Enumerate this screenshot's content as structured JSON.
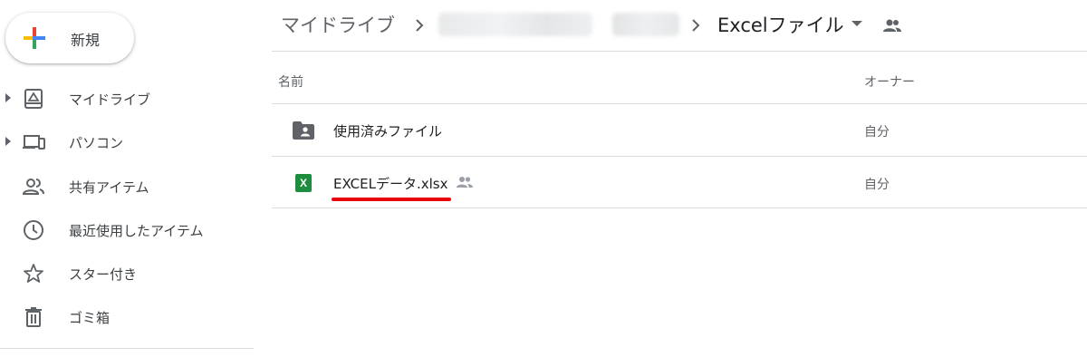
{
  "sidebar": {
    "new_button_label": "新規",
    "items": [
      {
        "label": "マイドライブ",
        "icon": "my-drive-icon",
        "expandable": true
      },
      {
        "label": "パソコン",
        "icon": "computers-icon",
        "expandable": true
      },
      {
        "label": "共有アイテム",
        "icon": "shared-with-me-icon",
        "expandable": false
      },
      {
        "label": "最近使用したアイテム",
        "icon": "clock-icon",
        "expandable": false
      },
      {
        "label": "スター付き",
        "icon": "star-icon",
        "expandable": false
      },
      {
        "label": "ゴミ箱",
        "icon": "trash-icon",
        "expandable": false
      }
    ]
  },
  "breadcrumb": {
    "root": "マイドライブ",
    "current": "Excelファイル"
  },
  "list": {
    "col_name": "名前",
    "col_owner": "オーナー",
    "rows": [
      {
        "name": "使用済みファイル",
        "owner": "自分",
        "type": "shared-folder"
      },
      {
        "name": "EXCELデータ.xlsx",
        "owner": "自分",
        "type": "excel-file",
        "shared": true
      }
    ]
  },
  "colors": {
    "accent_red_underline": "#e8000b",
    "excel_green": "#1e8e3e",
    "icon_gray": "#5f6368"
  }
}
